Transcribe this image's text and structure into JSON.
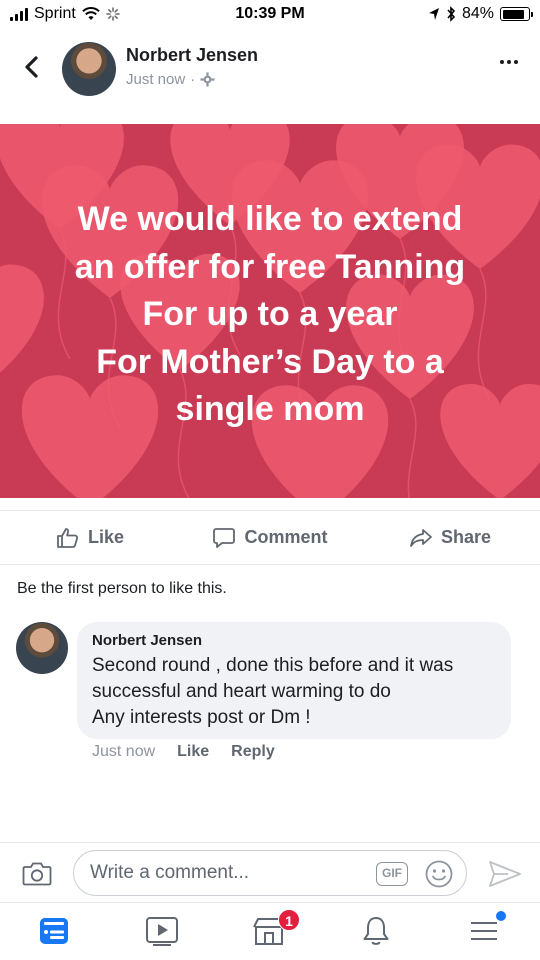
{
  "status_bar": {
    "carrier": "Sprint",
    "time": "10:39 PM",
    "battery_text": "84%",
    "battery_level": 0.84
  },
  "header": {
    "name": "Norbert Jensen",
    "timestamp": "Just now",
    "privacy_icon": "gear-icon"
  },
  "post": {
    "text": "We would like to extend\nan offer for free Tanning\nFor up to a year\nFor Mother’s Day to a\nsingle mom",
    "background_color": "#c93a55",
    "heart_color": "#ee5a6f"
  },
  "actions": {
    "like": "Like",
    "comment": "Comment",
    "share": "Share"
  },
  "likes_summary": "Be the first person to like this.",
  "comment": {
    "author": "Norbert Jensen",
    "text": "Second round , done this before and it was\nsuccessful and heart warming to do\nAny interests post or Dm !",
    "time": "Just now",
    "like": "Like",
    "reply": "Reply"
  },
  "composer": {
    "placeholder": "Write a comment...",
    "gif_label": "GIF"
  },
  "bottom_nav": {
    "marketplace_badge": "1",
    "accent_color": "#1877f2"
  }
}
